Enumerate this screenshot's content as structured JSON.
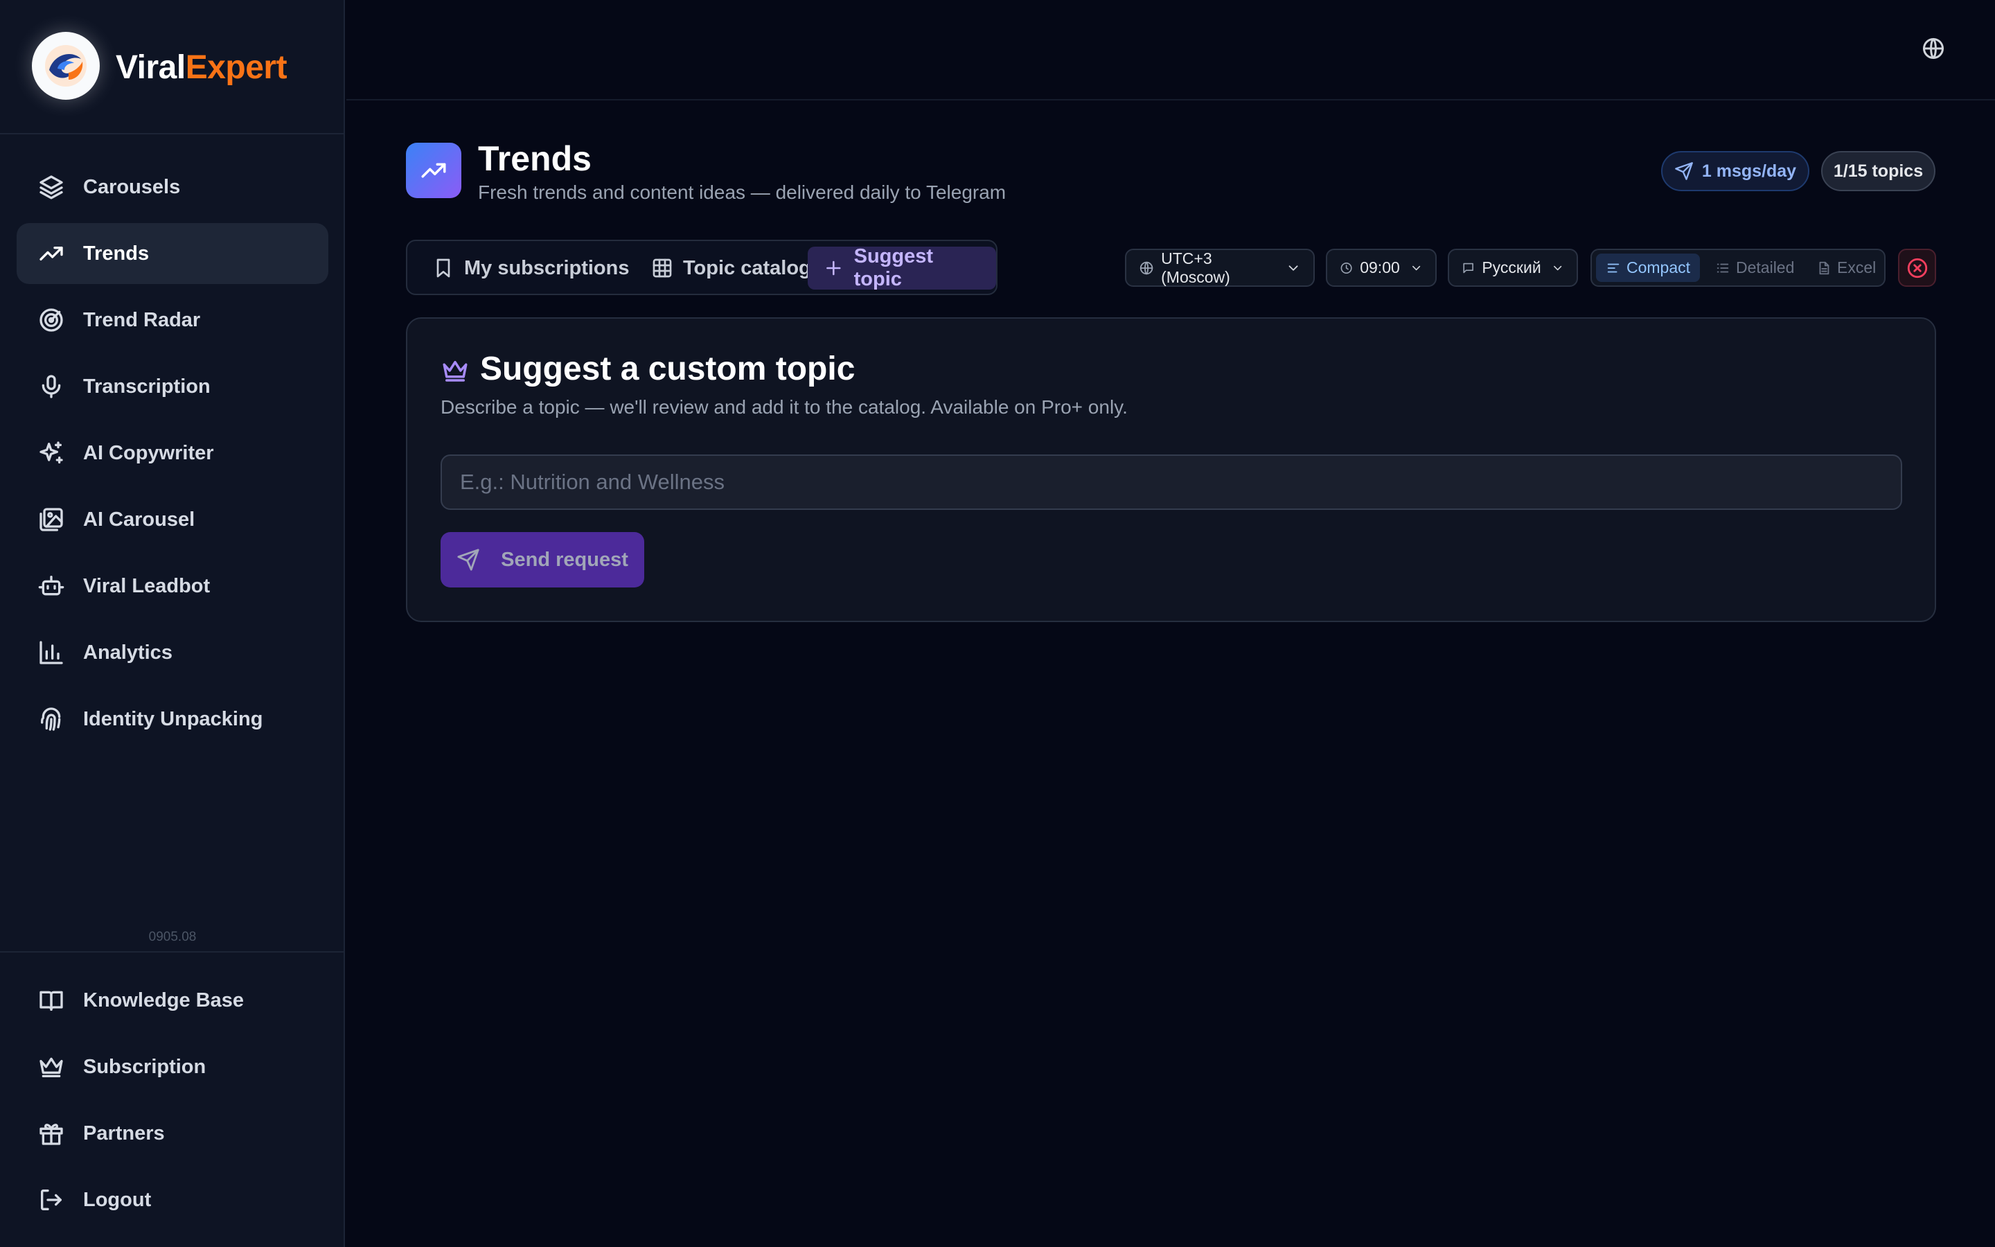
{
  "brand": {
    "name_part1": "Viral",
    "name_part2": "Expert"
  },
  "sidebar": {
    "items": [
      {
        "label": "Carousels",
        "icon": "layers-icon"
      },
      {
        "label": "Trends",
        "icon": "trending-up-icon",
        "active": true
      },
      {
        "label": "Trend Radar",
        "icon": "radar-icon"
      },
      {
        "label": "Transcription",
        "icon": "mic-icon"
      },
      {
        "label": "AI Copywriter",
        "icon": "sparkles-icon"
      },
      {
        "label": "AI Carousel",
        "icon": "images-icon"
      },
      {
        "label": "Viral Leadbot",
        "icon": "bot-icon"
      },
      {
        "label": "Analytics",
        "icon": "bar-chart-icon"
      },
      {
        "label": "Identity Unpacking",
        "icon": "fingerprint-icon"
      }
    ],
    "version": "0905.08",
    "bottom_items": [
      {
        "label": "Knowledge Base",
        "icon": "book-icon"
      },
      {
        "label": "Subscription",
        "icon": "crown-icon"
      },
      {
        "label": "Partners",
        "icon": "gift-icon"
      },
      {
        "label": "Logout",
        "icon": "logout-icon"
      }
    ]
  },
  "header": {
    "title": "Trends",
    "subtitle": "Fresh trends and content ideas — delivered daily to Telegram",
    "msgs_badge": "1 msgs/day",
    "topics_badge": "1/15 topics"
  },
  "tabs": [
    {
      "label": "My subscriptions",
      "icon": "bookmark-icon"
    },
    {
      "label": "Topic catalog",
      "icon": "grid-icon"
    },
    {
      "label": "Suggest topic",
      "icon": "plus-icon",
      "active": true
    }
  ],
  "filters": {
    "timezone": "UTC+3 (Moscow)",
    "time": "09:00",
    "language": "Русский",
    "views": [
      {
        "label": "Compact",
        "active": true
      },
      {
        "label": "Detailed"
      },
      {
        "label": "Excel"
      }
    ]
  },
  "suggest": {
    "title": "Suggest a custom topic",
    "description": "Describe a topic — we'll review and add it to the catalog. Available on Pro+ only.",
    "input_value": "",
    "placeholder": "E.g.: Nutrition and Wellness",
    "send_label": "Send request"
  },
  "colors": {
    "background": "#050816",
    "sidebar": "#0e1424",
    "accent_orange": "#f97316",
    "accent_purple": "#8b5cf6",
    "danger": "#f43f5e"
  }
}
